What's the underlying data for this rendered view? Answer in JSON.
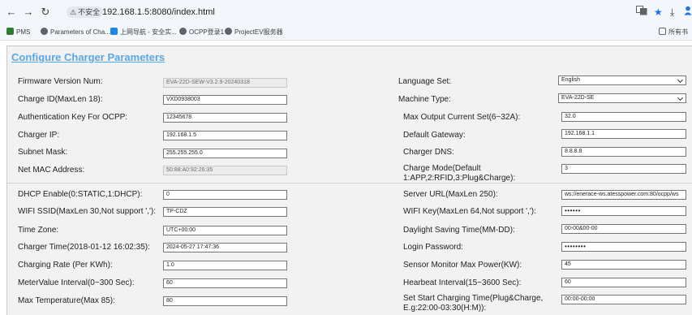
{
  "browser": {
    "security_label": "不安全",
    "url": "192.168.1.5:8080/index.html",
    "bookmarks": [
      "PMS",
      "Parameters of Cha...",
      "上网导航 - 安全实...",
      "OCPP登录1",
      "ProjectEV服务器"
    ],
    "all_bookmarks": "所有书"
  },
  "page": {
    "title": "Configure Charger Parameters",
    "firmware_label": "Firmware Version Num:",
    "firmware_value": "EVA-22D-SEW-V3.2.9-20240318",
    "charge_id_label": "Charge ID(MaxLen 18):",
    "charge_id_value": "VXD0938003",
    "auth_key_label": "Authentication Key For OCPP:",
    "auth_key_value": "12345678",
    "charger_ip_label": "Charger IP:",
    "charger_ip_value": "192.168.1.5",
    "subnet_label": "Subnet Mask:",
    "subnet_value": "255.255.255.0",
    "mac_label": "Net MAC Address:",
    "mac_value": "50:88:A0:92:26:35",
    "language_label": "Language Set:",
    "language_value": "English",
    "machine_type_label": "Machine Type:",
    "machine_type_value": "EVA-22D-SE",
    "max_current_label": "Max Output Current Set(6~32A):",
    "max_current_value": "32.0",
    "gateway_label": "Default Gateway:",
    "gateway_value": "192.168.1.1",
    "dns_label": "Charger DNS:",
    "dns_value": "8.8.8.8",
    "charge_mode_label": "Charge Mode(Default 1:APP,2:RFID,3:Plug&Charge):",
    "charge_mode_value": "3",
    "dhcp_label": "DHCP Enable(0:STATIC,1:DHCP):",
    "dhcp_value": "0",
    "ssid_label": "WIFI SSID(MaxLen 30,Not support ','):",
    "ssid_value": "TP-CDZ",
    "timezone_label": "Time Zone:",
    "timezone_value": "UTC+00:00",
    "charger_time_label": "Charger Time(2018-01-12 16:02:35):",
    "charger_time_value": "2024-05-27 17:47:36",
    "rate_label": "Charging Rate (Per KWh):",
    "rate_value": "1.0",
    "meter_label": "MeterValue Interval(0~300 Sec):",
    "meter_value": "60",
    "maxtemp_label": "Max Temperature(Max 85):",
    "maxtemp_value": "80",
    "server_url_label": "Server URL(MaxLen 250):",
    "server_url_value": "ws://enerace-ws.atesspower.com:80/ocpp/ws",
    "wifi_key_label": "WIFI Key(MaxLen 64,Not support ','):",
    "wifi_key_value": "••••••",
    "dst_label": "Daylight Saving Time(MM-DD):",
    "dst_value": "00-00&00-00",
    "login_pw_label": "Login Password:",
    "login_pw_value": "••••••••",
    "sensor_label": "Sensor Monitor Max Power(KW):",
    "sensor_value": "45",
    "heartbeat_label": "Hearbeat Interval(15~3600 Sec):",
    "heartbeat_value": "60",
    "start_time_label": "Set Start Charging Time(Plug&Charge, E.g:22:00-03:30(H:M)):",
    "start_time_value": "00:00-00:00"
  }
}
